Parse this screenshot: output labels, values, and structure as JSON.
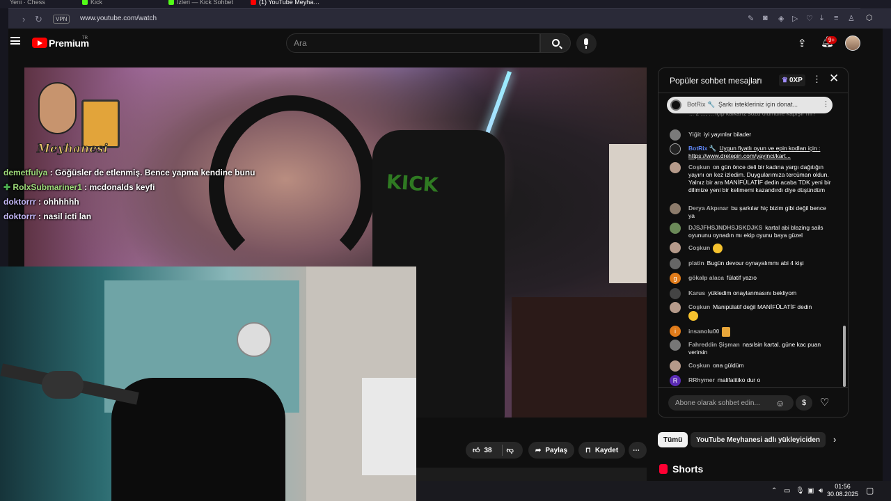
{
  "browser": {
    "tabs": [
      "Yeni · Chess",
      "Kick",
      "Izleri — Kick Sohbet",
      "(1) YouTube Meyha…"
    ],
    "url": "www.youtube.com/watch",
    "vpn_label": "VPN"
  },
  "header": {
    "brand": "Premium",
    "brand_sup": "TR",
    "search_placeholder": "Ara",
    "notif_count": "9+"
  },
  "video": {
    "logo_text": "Meyhanesi",
    "kick_text": "KICK",
    "overlay_chat": [
      {
        "name": "demetfulya",
        "text": ": Göğüsler de etlenmiş. Bence yapma kendine bunu"
      },
      {
        "name": "RolxSubmariner1",
        "text": ": mcdonalds keyfi"
      },
      {
        "name": "doktorrr",
        "text": ": ohhhhhh"
      },
      {
        "name": "doktorrr",
        "text": ": nasil icti lan"
      }
    ]
  },
  "actions": {
    "like_count": "38",
    "share": "Paylaş",
    "save": "Kaydet",
    "more": "⋯"
  },
  "chat": {
    "title": "Popüler sohbet mesajları",
    "xp": "0XP",
    "pinned": {
      "name": "BotRix 🔧",
      "text": "Şarkı istekleriniz için donat..."
    },
    "faded_text": "... 2 ..., ... içip kalkarız sözü ölümüne kapışır mı?",
    "messages": [
      {
        "name": "Yiğit",
        "text": "iyi yayınlar bilader"
      },
      {
        "name": "BotRix 🔧",
        "text": "Uygun fiyatlı oyun ve epin kodları için : https://www.dretepin.com/yayinci/kart..."
      },
      {
        "name": "Coşkun",
        "text": "on gün önce deli bir kadına yargı dağıtığın yayını on kez izledim. Duygularımıza tercüman oldun. Yalnız bir ara MANİFÜLATİF dedin acaba TDK yeni bir dilimize yeni bir kelimemi kazandırdı diye düşündüm"
      },
      {
        "name": "Derya Akpınar",
        "text": "bu şarkılar hiç bizim gibi değil bence ya"
      },
      {
        "name": "DJSJFHSJNDHSJSKDJKS",
        "text": "kartal abi blazing sails oyununu oynadın mı ekip oyunu baya güzel"
      },
      {
        "name": "Coşkun",
        "text": ""
      },
      {
        "name": "platin",
        "text": "Bugün devour oynayalımmı abi 4 kişi"
      },
      {
        "name": "gökalp alaca",
        "text": "fülatif yazıo"
      },
      {
        "name": "Karus",
        "text": "yükledim onaylanmasını bekliyom"
      },
      {
        "name": "Coşkun",
        "text": "Manipülatif değil MANİFÜLATİF dedin"
      },
      {
        "name": "insanolu00",
        "text": ""
      },
      {
        "name": "Fahreddin Şişman",
        "text": "nasılsin kartal. güne kac puan verirsin"
      },
      {
        "name": "Coşkun",
        "text": "ona güldüm"
      },
      {
        "name": "RRhymer",
        "text": "malifalitiko dur o"
      }
    ],
    "avatar_letters": {
      "g": "g",
      "i": "i",
      "r": "R"
    },
    "input_placeholder": "Abone olarak sohbet edin..."
  },
  "chips": {
    "all": "Tümü",
    "uploader": "YouTube Meyhanesi adlı yükleyiciden"
  },
  "shorts_label": "Shorts",
  "taskbar": {
    "time": "01:56",
    "date": "30.08.2025"
  },
  "colors": {
    "yt_red": "#ff0000",
    "overlay_name_green": "#9edb7a",
    "botrix_blue": "#5e84f1"
  }
}
